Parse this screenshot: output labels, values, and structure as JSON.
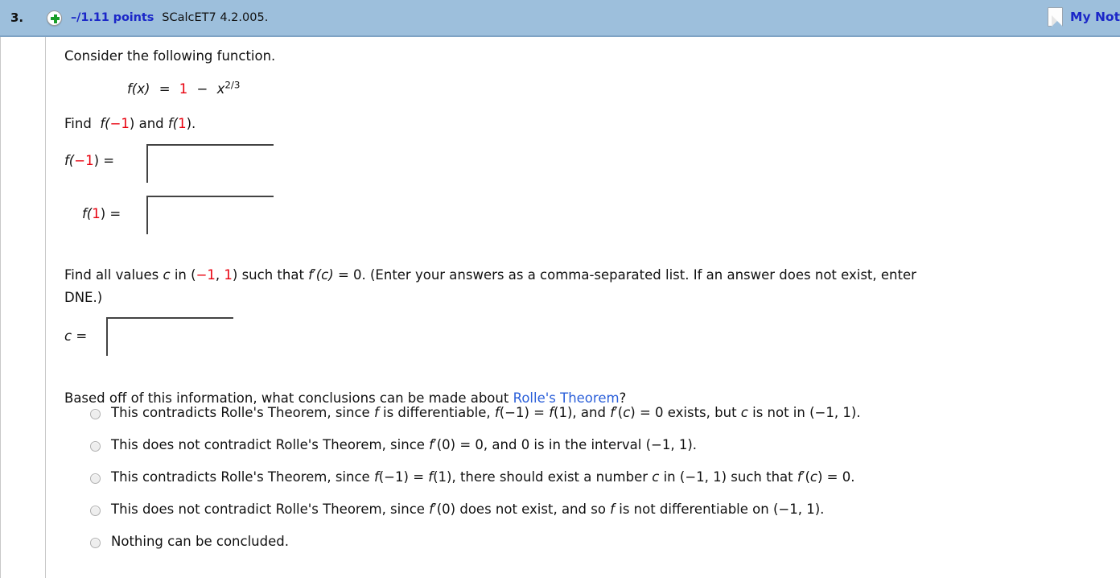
{
  "header": {
    "question_number": "3.",
    "expand_icon": "plus-circle-icon",
    "points": "–/1.11 points",
    "source_ref": "SCalcET7 4.2.005.",
    "notes_icon": "note-page-icon",
    "notes_label": "My Not"
  },
  "problem": {
    "prompt": "Consider the following function.",
    "formula": {
      "lhs": "f(x)",
      "equals": "=",
      "term_one": "1",
      "minus": "−",
      "base": "x",
      "exponent": "2/3"
    },
    "find_line": {
      "find": "Find",
      "fn_open": "f(",
      "neg_one": "−1",
      "fn_close": ")",
      "and": "and",
      "fn2_open": "f(",
      "one": "1",
      "fn2_close": ")."
    },
    "answers": [
      {
        "label_open": "f(",
        "label_value": "−1",
        "label_close": ") =",
        "value": "",
        "placeholder": ""
      },
      {
        "label_open": "f(",
        "label_value": "1",
        "label_close": ") =",
        "value": "",
        "placeholder": ""
      }
    ],
    "c_question": {
      "part1": "Find all values",
      "var_c": "c",
      "part2": "in (",
      "neg_one": "−1",
      "comma": ", ",
      "one": "1",
      "part3": ") such that",
      "fprime": "f′(c)",
      "part4": "= 0.  (Enter your answers as a comma-separated list. If an answer does not exist, enter",
      "part5": "DNE.)"
    },
    "c_field": {
      "label": "c =",
      "value": "",
      "placeholder": ""
    },
    "conclusion_question": {
      "before_link": "Based off of this information, what conclusions can be made about",
      "link_text": "Rolle's Theorem",
      "after_link": "?"
    },
    "options": [
      {
        "id": "option-1",
        "selected": false,
        "text": "This contradicts Rolle's Theorem, since f is differentiable, f(−1) = f(1), and f′(c) = 0 exists, but c is not in (−1, 1)."
      },
      {
        "id": "option-2",
        "selected": false,
        "text": "This does not contradict Rolle's Theorem, since f′(0) = 0, and 0 is in the interval (−1, 1)."
      },
      {
        "id": "option-3",
        "selected": false,
        "text": "This contradicts Rolle's Theorem, since f(−1) = f(1), there should exist a number c in (−1, 1) such that f′(c) = 0."
      },
      {
        "id": "option-4",
        "selected": false,
        "text": "This does not contradict Rolle's Theorem, since f′(0) does not exist, and so f is not differentiable on (−1, 1)."
      },
      {
        "id": "option-5",
        "selected": false,
        "text": "Nothing can be concluded."
      }
    ]
  },
  "colors": {
    "header_bg": "#9dbfdc",
    "link": "#1b27c8",
    "accent_red": "#e8000d",
    "theorem_link": "#2b5fd9",
    "plus_green": "#1a9d28"
  }
}
